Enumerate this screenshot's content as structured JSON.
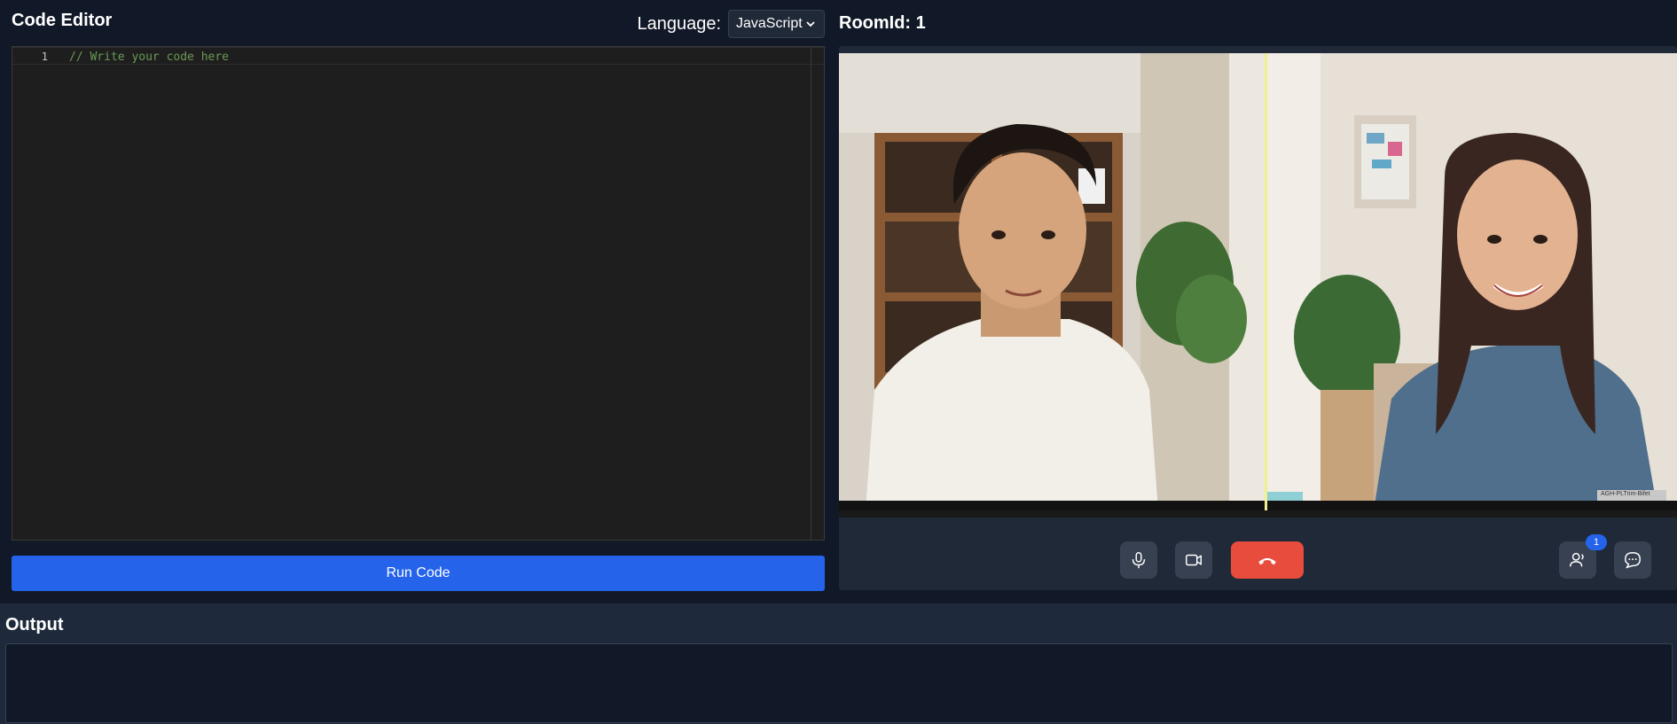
{
  "editor": {
    "title": "Code Editor",
    "language_label": "Language:",
    "language_value": "JavaScript",
    "lines": [
      {
        "number": "1",
        "text": "// Write your code here"
      }
    ],
    "run_label": "Run Code"
  },
  "call": {
    "room_label": "RoomId: 1",
    "participants": [
      {
        "role": "participant-male",
        "caption": ""
      },
      {
        "role": "participant-female",
        "caption": "AGH-PLTrim-Bifet"
      }
    ],
    "controls": [
      {
        "name": "microphone-icon"
      },
      {
        "name": "camera-icon"
      },
      {
        "name": "phone-hangup-icon"
      },
      {
        "name": "participants-icon"
      },
      {
        "name": "chat-icon"
      }
    ],
    "participants_count": "1"
  },
  "output": {
    "title": "Output",
    "content": ""
  },
  "colors": {
    "background": "#111827",
    "panel": "#1f2937",
    "accent": "#2563eb",
    "hangup": "#e74c3c",
    "comment": "#6a9955"
  }
}
